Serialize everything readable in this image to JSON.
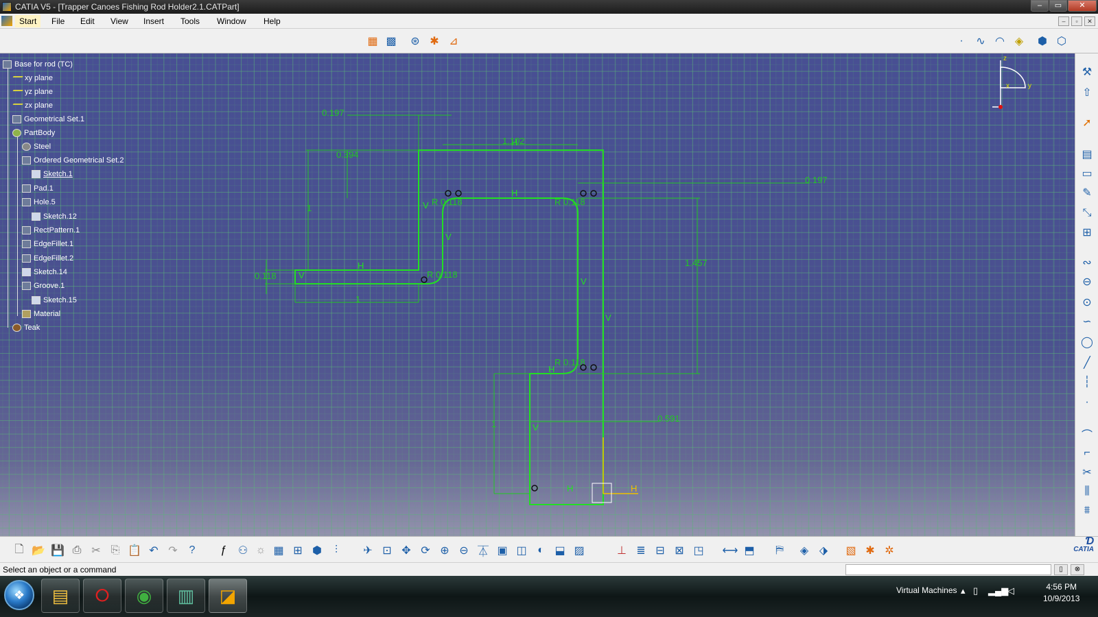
{
  "window": {
    "title": "CATIA V5 - [Trapper Canoes Fishing Rod Holder2.1.CATPart]",
    "controls": [
      "–",
      "▭",
      "✕"
    ]
  },
  "menu": {
    "items": [
      "Start",
      "File",
      "Edit",
      "View",
      "Insert",
      "Tools",
      "Window",
      "Help"
    ],
    "mdi_controls": [
      "–",
      "▫",
      "✕"
    ]
  },
  "tree": {
    "items": [
      {
        "label": "Base for rod (TC)",
        "icon": "part-icon"
      },
      {
        "label": "xy plane",
        "icon": "plane-icon"
      },
      {
        "label": "yz plane",
        "icon": "plane-icon"
      },
      {
        "label": "zx plane",
        "icon": "plane-icon"
      },
      {
        "label": "Geometrical Set.1",
        "icon": "geometrical-set-icon"
      },
      {
        "label": "PartBody",
        "icon": "body-icon"
      },
      {
        "label": "Steel",
        "icon": "material-sphere-icon"
      },
      {
        "label": "Ordered Geometrical Set.2",
        "icon": "ordered-set-icon"
      },
      {
        "label": "Sketch.1",
        "icon": "sketch-icon"
      },
      {
        "label": "Pad.1",
        "icon": "pad-icon"
      },
      {
        "label": "Hole.5",
        "icon": "hole-icon"
      },
      {
        "label": "Sketch.12",
        "icon": "sketch-icon"
      },
      {
        "label": "RectPattern.1",
        "icon": "pattern-icon"
      },
      {
        "label": "EdgeFillet.1",
        "icon": "fillet-icon"
      },
      {
        "label": "EdgeFillet.2",
        "icon": "fillet-icon"
      },
      {
        "label": "Sketch.14",
        "icon": "sketch-icon"
      },
      {
        "label": "Groove.1",
        "icon": "groove-icon"
      },
      {
        "label": "Sketch.15",
        "icon": "sketch-icon"
      },
      {
        "label": "Material",
        "icon": "material-icon"
      },
      {
        "label": "Teak",
        "icon": "teak-material-icon"
      }
    ]
  },
  "sketch": {
    "dimensions": {
      "d_top_left": "0.197",
      "d_top_width": "1.102",
      "d_offset": "0.394",
      "d_right_offset": "0.197",
      "d_left_height": "1",
      "d_thickness": "0.118",
      "d_bottom_left": "1",
      "d_right_height": "1.457",
      "d_lower_width": "0.591",
      "d_lower_height": "1"
    },
    "radii": {
      "r1": "R 0.118",
      "r2": "R 0.118",
      "r3": "R 0.118",
      "r4": "R 0.118"
    },
    "constraints": {
      "h": "H",
      "v": "V"
    },
    "colors": {
      "geometry": "#22e022",
      "dimension": "#22c822",
      "axis_h": "#f0c000"
    }
  },
  "compass": {
    "x_label": "x",
    "y_label": "y",
    "z_label": "z"
  },
  "status": {
    "message": "Select an object or a command"
  },
  "catia_logo": {
    "text": "CATIA"
  },
  "taskbar": {
    "tray_label": "Virtual Machines",
    "time": "4:56 PM",
    "date": "10/9/2013"
  }
}
